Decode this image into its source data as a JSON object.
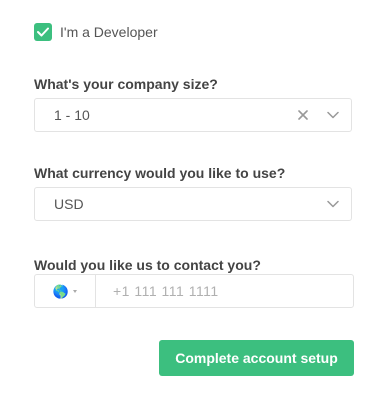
{
  "developer": {
    "label": "I'm a Developer",
    "checked": true
  },
  "company_size": {
    "label": "What's your company size?",
    "value": "1 - 10",
    "clear_icon": "close-icon",
    "chevron_icon": "chevron-down-icon"
  },
  "currency": {
    "label": "What currency would you like to use?",
    "value": "USD",
    "chevron_icon": "chevron-down-icon"
  },
  "contact": {
    "label": "Would you like us to contact you?",
    "country_icon": "globe-icon",
    "placeholder": "+1 111 111 1111",
    "value": ""
  },
  "submit": {
    "label": "Complete account setup"
  },
  "colors": {
    "accent": "#3cbf7f",
    "border": "#e3e3e3",
    "label_text": "#444444"
  }
}
